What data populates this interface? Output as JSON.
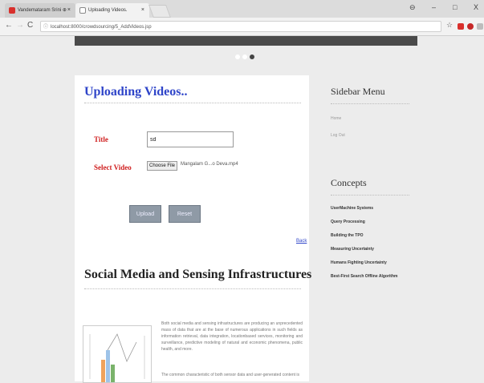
{
  "browser": {
    "tabs": [
      {
        "label": "Vandemataram Srini ⊕"
      },
      {
        "label": "Uploading Videos."
      }
    ],
    "url": "localhost:8000/crowdsourcing/5_AddVideos.jsp",
    "window_controls": {
      "minimize": "–",
      "maximize": "□",
      "close": "X"
    }
  },
  "main": {
    "heading": "Uploading Videos..",
    "form": {
      "title_label": "Title",
      "title_value": "sd",
      "video_label": "Select Video",
      "choose_file_label": "Choose File",
      "file_name": "Mangalam G...o Deva.mp4",
      "upload_label": "Upload",
      "reset_label": "Reset"
    },
    "back_label": "Back",
    "section_heading": "Social Media and Sensing Infrastructures",
    "paragraphs": [
      "Both social media and sensing infrastructures are producing an unprecedented mass of data that are at the base of numerous applications in such fields as information retrieval, data integration, locationbased services, monitoring and surveillance, predictive modeling of natural and economic phenomena, public health, and more.",
      "The common characteristic of both sensor data and user-generated content is"
    ]
  },
  "sidebar": {
    "menu_heading": "Sidebar Menu",
    "menu_items": [
      "Home",
      "Log Out"
    ],
    "concepts_heading": "Concepts",
    "concepts": [
      "UserMachine Systems",
      "Query Processing",
      "Building the TPO",
      "Measuring Uncertainty",
      "Humans Fighting Uncertainty",
      "Best-First Search Offline Algorithm"
    ]
  },
  "colors": {
    "accent_blue": "#2f45c9",
    "label_red": "#d02121",
    "button_gray": "#8f9aa6"
  }
}
